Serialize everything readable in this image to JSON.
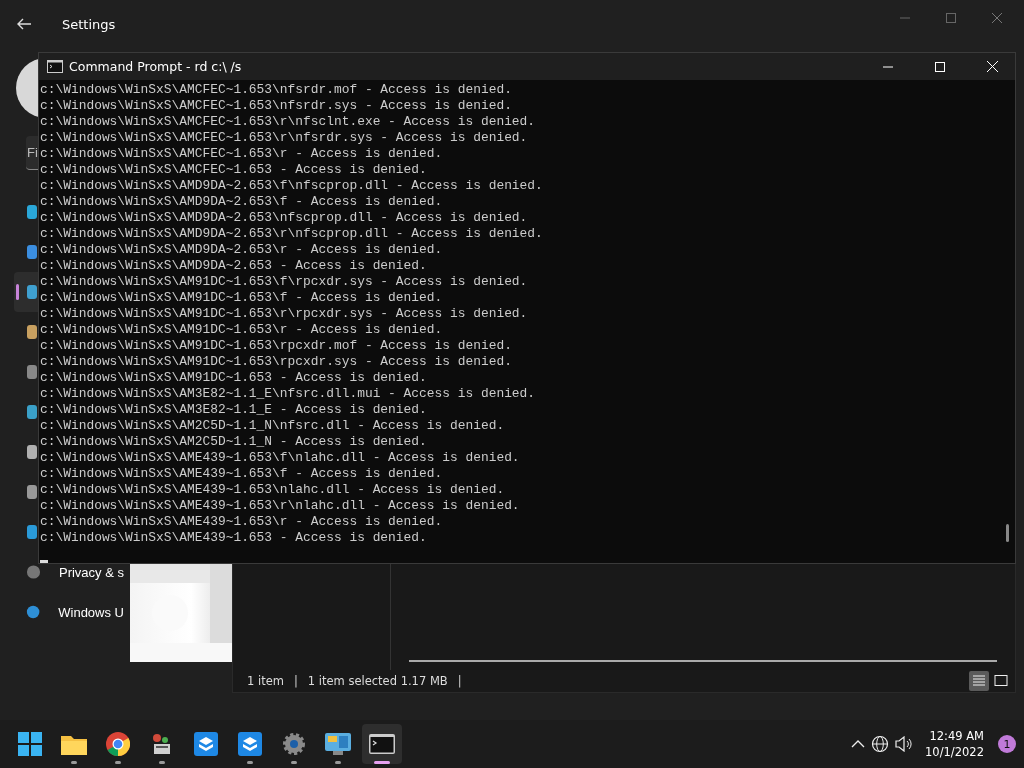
{
  "settings": {
    "title": "Settings",
    "search": {
      "placeholder": "Fi"
    },
    "nav": [
      {
        "selected": false,
        "color": "#2aa7d8"
      },
      {
        "selected": false,
        "color": "#3b8ee0"
      },
      {
        "selected": true,
        "color": "#3fa0d0"
      },
      {
        "selected": false,
        "color": "#c8a060"
      },
      {
        "selected": false,
        "color": "#888888"
      },
      {
        "selected": false,
        "color": "#3aa0c8"
      },
      {
        "selected": false,
        "color": "#b0b0b0"
      },
      {
        "selected": false,
        "color": "#999999"
      },
      {
        "selected": false,
        "color": "#2a9ad8"
      },
      {
        "selected": false,
        "label": "Privacy & s",
        "color": "#777777"
      },
      {
        "selected": false,
        "label": "Windows U",
        "color": "#2e8fd6"
      }
    ]
  },
  "explorer": {
    "status": [
      "1 item",
      "|",
      "1 item selected  1.17 MB",
      "|"
    ],
    "views": [
      {
        "selected": true
      },
      {
        "selected": false
      }
    ]
  },
  "console": {
    "title": "Command Prompt - rd  c:\\ /s",
    "lines": [
      "c:\\Windows\\WinSxS\\AMCFEC~1.653\\nfsrdr.mof - Access is denied.",
      "c:\\Windows\\WinSxS\\AMCFEC~1.653\\nfsrdr.sys - Access is denied.",
      "c:\\Windows\\WinSxS\\AMCFEC~1.653\\r\\nfsclnt.exe - Access is denied.",
      "c:\\Windows\\WinSxS\\AMCFEC~1.653\\r\\nfsrdr.sys - Access is denied.",
      "c:\\Windows\\WinSxS\\AMCFEC~1.653\\r - Access is denied.",
      "c:\\Windows\\WinSxS\\AMCFEC~1.653 - Access is denied.",
      "c:\\Windows\\WinSxS\\AMD9DA~2.653\\f\\nfscprop.dll - Access is denied.",
      "c:\\Windows\\WinSxS\\AMD9DA~2.653\\f - Access is denied.",
      "c:\\Windows\\WinSxS\\AMD9DA~2.653\\nfscprop.dll - Access is denied.",
      "c:\\Windows\\WinSxS\\AMD9DA~2.653\\r\\nfscprop.dll - Access is denied.",
      "c:\\Windows\\WinSxS\\AMD9DA~2.653\\r - Access is denied.",
      "c:\\Windows\\WinSxS\\AMD9DA~2.653 - Access is denied.",
      "c:\\Windows\\WinSxS\\AM91DC~1.653\\f\\rpcxdr.sys - Access is denied.",
      "c:\\Windows\\WinSxS\\AM91DC~1.653\\f - Access is denied.",
      "c:\\Windows\\WinSxS\\AM91DC~1.653\\r\\rpcxdr.sys - Access is denied.",
      "c:\\Windows\\WinSxS\\AM91DC~1.653\\r - Access is denied.",
      "c:\\Windows\\WinSxS\\AM91DC~1.653\\rpcxdr.mof - Access is denied.",
      "c:\\Windows\\WinSxS\\AM91DC~1.653\\rpcxdr.sys - Access is denied.",
      "c:\\Windows\\WinSxS\\AM91DC~1.653 - Access is denied.",
      "c:\\Windows\\WinSxS\\AM3E82~1.1_E\\nfsrc.dll.mui - Access is denied.",
      "c:\\Windows\\WinSxS\\AM3E82~1.1_E - Access is denied.",
      "c:\\Windows\\WinSxS\\AM2C5D~1.1_N\\nfsrc.dll - Access is denied.",
      "c:\\Windows\\WinSxS\\AM2C5D~1.1_N - Access is denied.",
      "c:\\Windows\\WinSxS\\AME439~1.653\\f\\nlahc.dll - Access is denied.",
      "c:\\Windows\\WinSxS\\AME439~1.653\\f - Access is denied.",
      "c:\\Windows\\WinSxS\\AME439~1.653\\nlahc.dll - Access is denied.",
      "c:\\Windows\\WinSxS\\AME439~1.653\\r\\nlahc.dll - Access is denied.",
      "c:\\Windows\\WinSxS\\AME439~1.653\\r - Access is denied.",
      "c:\\Windows\\WinSxS\\AME439~1.653 - Access is denied."
    ]
  },
  "taskbar": {
    "apps": [
      {
        "kind": "start",
        "running": false,
        "active": false
      },
      {
        "kind": "folder",
        "running": true,
        "active": false
      },
      {
        "kind": "browser",
        "running": true,
        "active": false
      },
      {
        "kind": "tool",
        "running": true,
        "active": false
      },
      {
        "kind": "box",
        "running": false,
        "active": false
      },
      {
        "kind": "box",
        "running": true,
        "active": false
      },
      {
        "kind": "gear",
        "running": true,
        "active": false
      },
      {
        "kind": "panel",
        "running": true,
        "active": false
      },
      {
        "kind": "terminal",
        "running": true,
        "active": true
      }
    ],
    "time": "12:49 AM",
    "date": "10/1/2022",
    "badge": "1"
  }
}
